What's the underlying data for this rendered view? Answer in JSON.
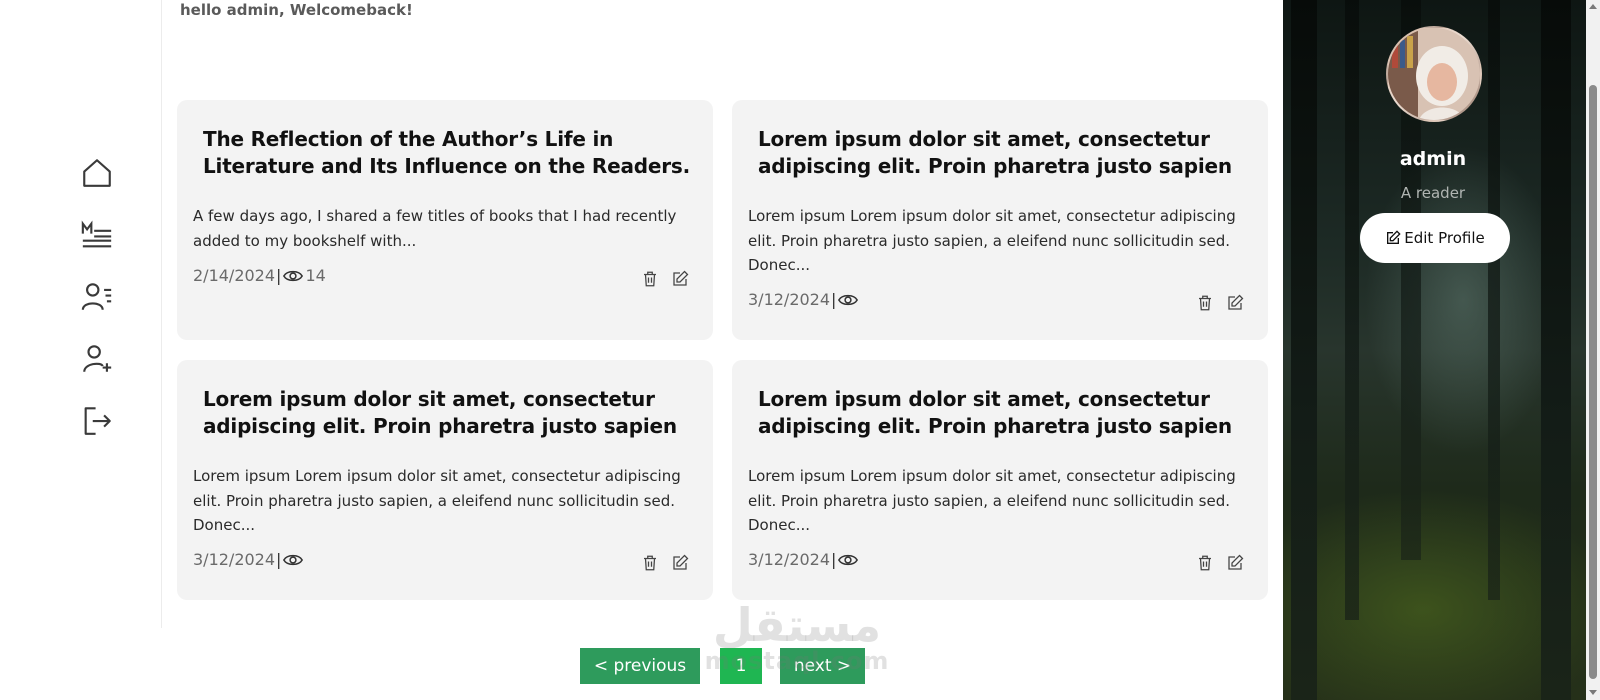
{
  "greeting": "hello admin, Welcomeback!",
  "sidebar": {
    "items": [
      {
        "icon": "home-icon"
      },
      {
        "icon": "markdown-list-icon"
      },
      {
        "icon": "user-list-icon"
      },
      {
        "icon": "add-user-icon"
      },
      {
        "icon": "logout-icon"
      }
    ]
  },
  "cards": [
    {
      "title": "The Reflection of the Author’s Life in Literature and Its Influence on the Readers.",
      "excerpt": "A few days ago, I shared a few titles of books that I had recently added to my bookshelf with...",
      "date": "2/14/2024",
      "separator": "|",
      "views": "14"
    },
    {
      "title": "Lorem ipsum dolor sit amet, consectetur adipiscing elit. Proin pharetra justo sapien",
      "excerpt": "Lorem ipsum Lorem ipsum dolor sit amet, consectetur adipiscing elit. Proin pharetra justo sapien, a eleifend nunc sollicitudin sed. Donec...",
      "date": "3/12/2024",
      "separator": "|",
      "views": ""
    },
    {
      "title": "Lorem ipsum dolor sit amet, consectetur adipiscing elit. Proin pharetra justo sapien",
      "excerpt": "Lorem ipsum Lorem ipsum dolor sit amet, consectetur adipiscing elit. Proin pharetra justo sapien, a eleifend nunc sollicitudin sed. Donec...",
      "date": "3/12/2024",
      "separator": "|",
      "views": ""
    },
    {
      "title": "Lorem ipsum dolor sit amet, consectetur adipiscing elit. Proin pharetra justo sapien",
      "excerpt": "Lorem ipsum Lorem ipsum dolor sit amet, consectetur adipiscing elit. Proin pharetra justo sapien, a eleifend nunc sollicitudin sed. Donec...",
      "date": "3/12/2024",
      "separator": "|",
      "views": ""
    }
  ],
  "profile": {
    "name": "admin",
    "role": "A reader",
    "edit_label": "Edit Profile"
  },
  "pagination": {
    "previous_label": "< previous",
    "page": "1",
    "next_label": "next >"
  },
  "watermark": {
    "arabic": "مستقل",
    "latin": "mostaql.com"
  },
  "colors": {
    "pager_green": "#2e9b5c",
    "pager_active": "#1fb652",
    "card_bg": "#f3f3f3"
  }
}
